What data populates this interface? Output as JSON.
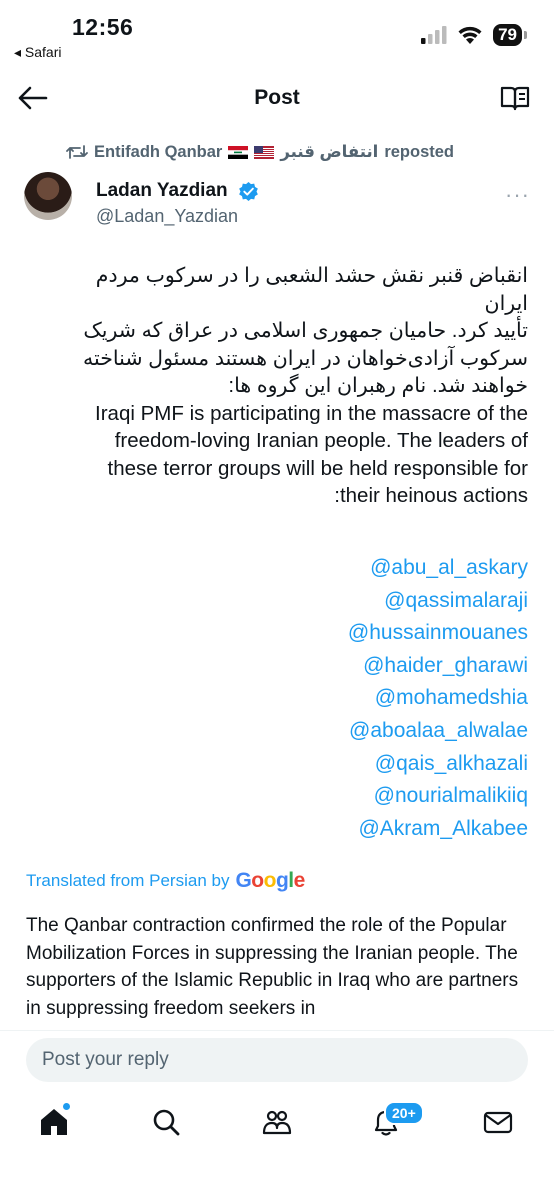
{
  "status_bar": {
    "time": "12:56",
    "back_app": "◂ Safari",
    "battery": "79",
    "icons": [
      "signal-icon",
      "wifi-icon",
      "battery-icon"
    ]
  },
  "header": {
    "title": "Post",
    "back_icon": "back-arrow-icon",
    "reader_icon": "reader-icon"
  },
  "repost": {
    "reposter": "Entifadh Qanbar",
    "reposter_alt": "انتفاض قنبر",
    "suffix": "reposted",
    "flags": [
      "iraq-flag",
      "usa-flag"
    ]
  },
  "author": {
    "name": "Ladan Yazdian",
    "handle": "@Ladan_Yazdian",
    "verified": true,
    "more": "···"
  },
  "body": {
    "lines": [
      "انقباض قنبر نقش حشد الشعبی را در سرکوب مردم ایران",
      "تأیید کرد. حامیان جمهوری اسلامی در عراق که شریک",
      "سرکوب آزادی‌خواهان در ایران هستند مسئول شناخته",
      "خواهند شد. نام رهبران این گروه ها:",
      "Iraqi PMF is participating in the massacre of the",
      "freedom-loving Iranian people. The leaders of",
      "these terror groups will be held responsible for",
      ":their heinous actions"
    ],
    "mentions": [
      "@abu_al_askary",
      "@qassimalaraji",
      "@hussainmouanes",
      "@haider_gharawi",
      "@mohamedshia",
      "@aboalaa_alwalae",
      "@qais_alkhazali",
      "@nourialmalikiiq",
      "@Akram_Alkabee"
    ]
  },
  "translation": {
    "label": "Translated from Persian by",
    "brand": "Google",
    "text": "The Qanbar contraction confirmed the role of the Popular Mobilization Forces in suppressing the Iranian people. The supporters of the Islamic Republic in Iraq who are partners in suppressing freedom seekers in"
  },
  "reply": {
    "placeholder": "Post your reply"
  },
  "tabbar": {
    "items": [
      "home-icon",
      "search-icon",
      "communities-icon",
      "notifications-icon",
      "messages-icon"
    ],
    "notifications_badge": "20+"
  },
  "colors": {
    "accent": "#1d9bf0",
    "text": "#0f1419",
    "secondary": "#536471"
  }
}
